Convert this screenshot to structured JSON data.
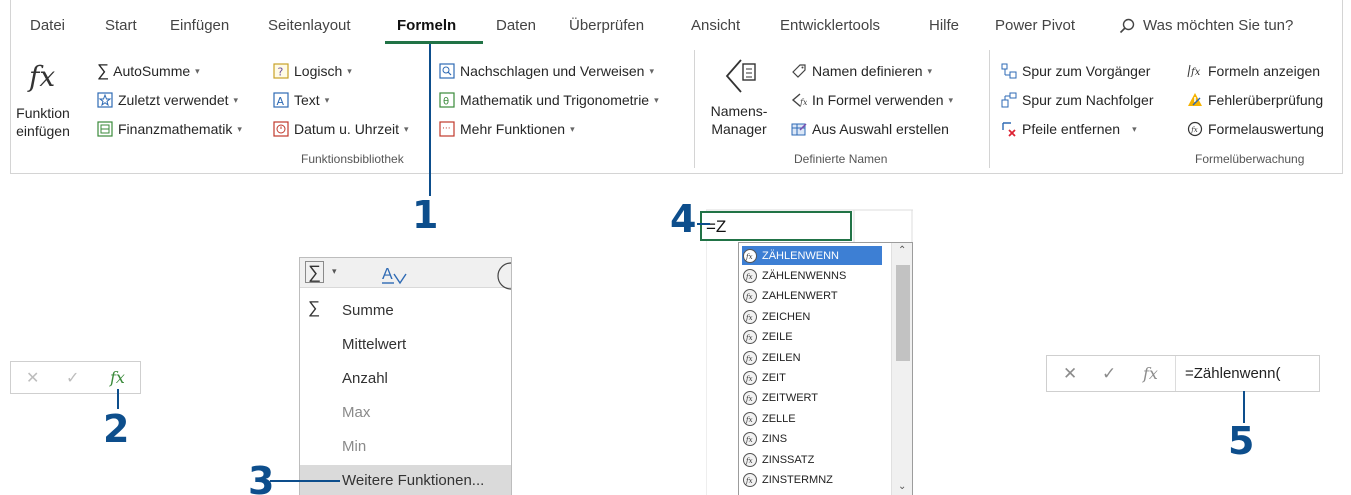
{
  "ribbon": {
    "tabs": [
      "Datei",
      "Start",
      "Einfügen",
      "Seitenlayout",
      "Formeln",
      "Daten",
      "Überprüfen",
      "Ansicht",
      "Entwicklertools",
      "Hilfe",
      "Power Pivot"
    ],
    "active_tab": "Formeln",
    "search_text": "Was möchten Sie tun?",
    "insert_function": {
      "line1": "Funktion",
      "line2": "einfügen"
    },
    "function_library": {
      "label": "Funktionsbibliothek",
      "autosum": "AutoSumme",
      "recent": "Zuletzt verwendet",
      "financial": "Finanzmathematik",
      "logical": "Logisch",
      "text": "Text",
      "datetime": "Datum u. Uhrzeit",
      "lookup": "Nachschlagen und Verweisen",
      "math": "Mathematik und Trigonometrie",
      "more": "Mehr Funktionen"
    },
    "defined_names": {
      "label": "Definierte Namen",
      "manager_line1": "Namens-",
      "manager_line2": "Manager",
      "define": "Namen definieren",
      "use_in_formula": "In Formel verwenden",
      "create_from_selection": "Aus Auswahl erstellen"
    },
    "formula_auditing": {
      "label": "Formelüberwachung",
      "trace_precedents": "Spur zum Vorgänger",
      "trace_dependents": "Spur zum Nachfolger",
      "remove_arrows": "Pfeile entfernen",
      "show_formulas": "Formeln anzeigen",
      "error_checking": "Fehlerüberprüfung",
      "evaluate_formula": "Formelauswertung"
    }
  },
  "callouts": [
    "1",
    "2",
    "3",
    "4",
    "5"
  ],
  "formula_bar_small": {
    "fx": "fx"
  },
  "autosum_dropdown": {
    "items": [
      {
        "label": "Summe",
        "underline": "S"
      },
      {
        "label": "Mittelwert",
        "underline": "M"
      },
      {
        "label": "Anzahl",
        "underline": "A"
      },
      {
        "label": "Max",
        "underline": "x"
      },
      {
        "label": "Min",
        "underline": "n"
      },
      {
        "label": "Weitere Funktionen...",
        "underline": "W"
      }
    ]
  },
  "autocomplete": {
    "cell_text": "=Z",
    "items": [
      "ZÄHLENWENN",
      "ZÄHLENWENNS",
      "ZAHLENWERT",
      "ZEICHEN",
      "ZEILE",
      "ZEILEN",
      "ZEIT",
      "ZEITWERT",
      "ZELLE",
      "ZINS",
      "ZINSSATZ",
      "ZINSTERMNZ"
    ],
    "selected_index": 0
  },
  "formula_bar_large": {
    "fx": "fx",
    "formula": "=Zählenwenn("
  },
  "colors": {
    "accent": "#217346",
    "callout": "#0d4e8c",
    "selection": "#3d7fd4"
  }
}
